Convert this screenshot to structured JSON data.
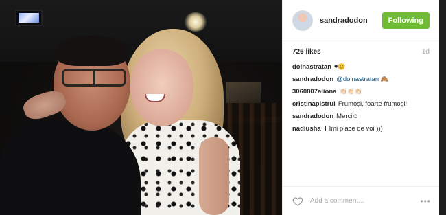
{
  "post": {
    "username": "sandradodon",
    "follow_label": "Following",
    "likes": "726 likes",
    "age": "1d",
    "comment_placeholder": "Add a comment...",
    "more_label": "•••",
    "heart_glyph": "♥",
    "accent_color": "#6fbb35"
  },
  "comments": [
    {
      "user": "doinastratan",
      "text": "",
      "emoji": "♥😊"
    },
    {
      "user": "sandradodon",
      "mention": "@doinastratan",
      "text": "",
      "emoji": "🙈"
    },
    {
      "user": "3060807aliona",
      "text": "",
      "emoji": "👏🏻👏🏻👏🏻"
    },
    {
      "user": "cristinapistrui",
      "text": "Frumoși, foarte frumoși!"
    },
    {
      "user": "sandradodon",
      "text": "Merci☺"
    },
    {
      "user": "nadiusha_l",
      "text": "Imi place de voi )))"
    }
  ]
}
